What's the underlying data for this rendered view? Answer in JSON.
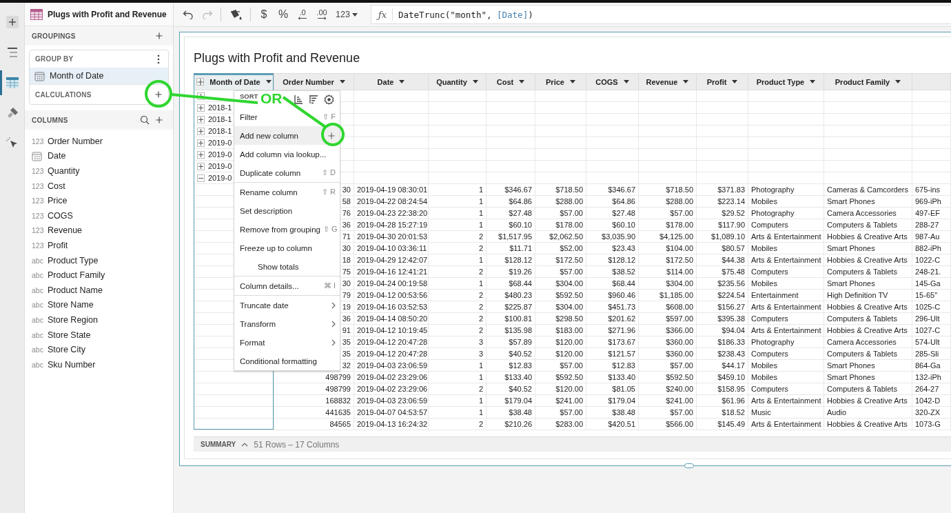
{
  "rail": {
    "items": [
      {
        "kind": "add",
        "selected": false
      },
      {
        "kind": "outline",
        "selected": false
      },
      {
        "kind": "table",
        "selected": true
      },
      {
        "kind": "brush",
        "selected": false
      },
      {
        "kind": "pointer",
        "selected": false
      }
    ]
  },
  "panel": {
    "title": "Plugs with Profit and Revenue",
    "groupings_label": "GROUPINGS",
    "group_by_label": "GROUP BY",
    "group_by": [
      {
        "kind": "date",
        "name": "Month of Date",
        "selected": true
      }
    ],
    "calculations_label": "CALCULATIONS",
    "columns_label": "COLUMNS",
    "columns": [
      {
        "kind": "number",
        "type_label": "123",
        "name": "Order Number"
      },
      {
        "kind": "date",
        "name": "Date"
      },
      {
        "kind": "number",
        "type_label": "123",
        "name": "Quantity"
      },
      {
        "kind": "number",
        "type_label": "123",
        "name": "Cost"
      },
      {
        "kind": "number",
        "type_label": "123",
        "name": "Price"
      },
      {
        "kind": "number",
        "type_label": "123",
        "name": "COGS"
      },
      {
        "kind": "number",
        "type_label": "123",
        "name": "Revenue"
      },
      {
        "kind": "number",
        "type_label": "123",
        "name": "Profit"
      },
      {
        "kind": "text",
        "type_label": "abc",
        "name": "Product Type"
      },
      {
        "kind": "text",
        "type_label": "abc",
        "name": "Product Family"
      },
      {
        "kind": "text",
        "type_label": "abc",
        "name": "Product Name"
      },
      {
        "kind": "text",
        "type_label": "abc",
        "name": "Store Name"
      },
      {
        "kind": "text",
        "type_label": "abc",
        "name": "Store Region"
      },
      {
        "kind": "text",
        "type_label": "abc",
        "name": "Store State"
      },
      {
        "kind": "text",
        "type_label": "abc",
        "name": "Store City"
      },
      {
        "kind": "text",
        "type_label": "abc",
        "name": "Sku Number"
      }
    ]
  },
  "toolbar": {
    "buttons": [
      {
        "kind": "undo",
        "disabled": false
      },
      {
        "kind": "redo",
        "disabled": true
      },
      {
        "kind": "fill",
        "disabled": false
      },
      {
        "kind": "symbol",
        "text": "$",
        "disabled": false
      },
      {
        "kind": "symbol",
        "text": "%",
        "disabled": false
      },
      {
        "kind": "decimal_less",
        "text": ".0",
        "disabled": false
      },
      {
        "kind": "decimal_more",
        "text": ".00",
        "disabled": false
      },
      {
        "kind": "dropdown",
        "text": "123",
        "disabled": false
      }
    ]
  },
  "formula": {
    "symbol": "ƒx",
    "parts": [
      {
        "kind": "plain",
        "text": "DateTrunc(\"month\", "
      },
      {
        "kind": "ref",
        "text": "[Date]"
      },
      {
        "kind": "plain",
        "text": ")"
      }
    ]
  },
  "element": {
    "title": "Plugs with Profit and Revenue",
    "table": {
      "columns": [
        {
          "kind": "group",
          "label": "Month of Date",
          "selected": true
        },
        {
          "kind": "number",
          "label": "Order Number",
          "selected": false
        },
        {
          "kind": "date",
          "label": "Date",
          "selected": false
        },
        {
          "kind": "number",
          "label": "Quantity",
          "selected": false
        },
        {
          "kind": "number",
          "label": "Cost",
          "selected": false
        },
        {
          "kind": "number",
          "label": "Price",
          "selected": false
        },
        {
          "kind": "number",
          "label": "COGS",
          "selected": false
        },
        {
          "kind": "number",
          "label": "Revenue",
          "selected": false
        },
        {
          "kind": "number",
          "label": "Profit",
          "selected": false
        },
        {
          "kind": "text",
          "label": "Product Type",
          "selected": false
        },
        {
          "kind": "text",
          "label": "Product Family",
          "selected": false
        },
        {
          "kind": "text",
          "selected": false
        }
      ],
      "group_rows": [
        {
          "expanded": false
        },
        {
          "label": "2018-1",
          "expanded": false
        },
        {
          "label": "2018-1",
          "expanded": false
        },
        {
          "label": "2018-1",
          "expanded": false
        },
        {
          "label": "2019-0",
          "expanded": false
        },
        {
          "label": "2019-0",
          "expanded": false
        },
        {
          "label": "2019-0",
          "expanded": false
        },
        {
          "label": "2019-0",
          "expanded": true
        }
      ],
      "rows": [
        [
          "",
          "30",
          "2019-04-19 08:30:01",
          "1",
          "$346.67",
          "$718.50",
          "$346.67",
          "$718.50",
          "$371.83",
          "Photography",
          "Cameras & Camcorders",
          "675-ins"
        ],
        [
          "",
          "58",
          "2019-04-22 08:24:54",
          "1",
          "$64.86",
          "$288.00",
          "$64.86",
          "$288.00",
          "$223.14",
          "Mobiles",
          "Smart Phones",
          "969-iPh"
        ],
        [
          "",
          "76",
          "2019-04-23 22:38:20",
          "1",
          "$27.48",
          "$57.00",
          "$27.48",
          "$57.00",
          "$29.52",
          "Photography",
          "Camera Accessories",
          "497-EF"
        ],
        [
          "",
          "36",
          "2019-04-28 15:27:19",
          "1",
          "$60.10",
          "$178.00",
          "$60.10",
          "$178.00",
          "$117.90",
          "Computers",
          "Computers & Tablets",
          "288-27"
        ],
        [
          "",
          "71",
          "2019-04-30 20:01:53",
          "2",
          "$1,517.95",
          "$2,062.50",
          "$3,035.90",
          "$4,125.00",
          "$1,089.10",
          "Arts & Entertainment",
          "Hobbies & Creative Arts",
          "987-Au"
        ],
        [
          "",
          "30",
          "2019-04-10 03:36:11",
          "2",
          "$11.71",
          "$52.00",
          "$23.43",
          "$104.00",
          "$80.57",
          "Mobiles",
          "Smart Phones",
          "882-iPh"
        ],
        [
          "",
          "18",
          "2019-04-29 12:42:07",
          "1",
          "$128.12",
          "$172.50",
          "$128.12",
          "$172.50",
          "$44.38",
          "Arts & Entertainment",
          "Hobbies & Creative Arts",
          "1022-C"
        ],
        [
          "",
          "75",
          "2019-04-16 12:41:21",
          "2",
          "$19.26",
          "$57.00",
          "$38.52",
          "$114.00",
          "$75.48",
          "Computers",
          "Computers & Tablets",
          "248-21."
        ],
        [
          "",
          "30",
          "2019-04-24 00:19:58",
          "1",
          "$68.44",
          "$304.00",
          "$68.44",
          "$304.00",
          "$235.56",
          "Mobiles",
          "Smart Phones",
          "145-Ga"
        ],
        [
          "",
          "79",
          "2019-04-12 00:53:56",
          "2",
          "$480.23",
          "$592.50",
          "$960.46",
          "$1,185.00",
          "$224.54",
          "Entertainment",
          "High Definition TV",
          "15-65\""
        ],
        [
          "",
          "19",
          "2019-04-16 03:52:53",
          "2",
          "$225.87",
          "$304.00",
          "$451.73",
          "$608.00",
          "$156.27",
          "Arts & Entertainment",
          "Hobbies & Creative Arts",
          "1025-C"
        ],
        [
          "",
          "36",
          "2019-04-14 08:50:20",
          "2",
          "$100.81",
          "$298.50",
          "$201.62",
          "$597.00",
          "$395.38",
          "Computers",
          "Computers & Tablets",
          "296-Ult"
        ],
        [
          "",
          "91",
          "2019-04-12 10:19:45",
          "2",
          "$135.98",
          "$183.00",
          "$271.96",
          "$366.00",
          "$94.04",
          "Arts & Entertainment",
          "Hobbies & Creative Arts",
          "1027-C"
        ],
        [
          "",
          "35",
          "2019-04-12 20:47:28",
          "3",
          "$57.89",
          "$120.00",
          "$173.67",
          "$360.00",
          "$186.33",
          "Photography",
          "Camera Accessories",
          "574-Ult"
        ],
        [
          "",
          "35",
          "2019-04-12 20:47:28",
          "3",
          "$40.52",
          "$120.00",
          "$121.57",
          "$360.00",
          "$238.43",
          "Computers",
          "Computers & Tablets",
          "285-Sli"
        ],
        [
          "",
          "32",
          "2019-04-03 23:06:59",
          "1",
          "$12.83",
          "$57.00",
          "$12.83",
          "$57.00",
          "$44.17",
          "Mobiles",
          "Smart Phones",
          "864-Ga"
        ],
        [
          "",
          "498799",
          "2019-04-02 23:29:06",
          "1",
          "$133.40",
          "$592.50",
          "$133.40",
          "$592.50",
          "$459.10",
          "Mobiles",
          "Smart Phones",
          "132-iPh"
        ],
        [
          "",
          "498799",
          "2019-04-02 23:29:06",
          "2",
          "$40.52",
          "$120.00",
          "$81.05",
          "$240.00",
          "$158.95",
          "Computers",
          "Computers & Tablets",
          "264-27"
        ],
        [
          "",
          "168832",
          "2019-04-03 23:06:59",
          "1",
          "$179.04",
          "$241.00",
          "$179.04",
          "$241.00",
          "$61.96",
          "Arts & Entertainment",
          "Hobbies & Creative Arts",
          "1042-D"
        ],
        [
          "",
          "441635",
          "2019-04-07 04:53:57",
          "1",
          "$38.48",
          "$57.00",
          "$38.48",
          "$57.00",
          "$18.52",
          "Music",
          "Audio",
          "320-ZX"
        ],
        [
          "",
          "84565",
          "2019-04-13 16:24:32",
          "2",
          "$210.26",
          "$283.00",
          "$420.51",
          "$566.00",
          "$145.49",
          "Arts & Entertainment",
          "Hobbies & Creative Arts",
          "1073-G"
        ]
      ]
    },
    "menu": {
      "heading": "SORT",
      "items": [
        {
          "kind": "item",
          "label": "Filter",
          "shortcut": "⇧ F",
          "highlighted": false
        },
        {
          "kind": "add",
          "label": "Add new column",
          "highlighted": true
        },
        {
          "kind": "item",
          "label": "Add column via lookup...",
          "highlighted": false
        },
        {
          "kind": "item",
          "label": "Duplicate column",
          "shortcut": "⇧ D",
          "highlighted": false
        },
        {
          "kind": "divider"
        },
        {
          "kind": "item",
          "label": "Rename column",
          "shortcut": "⇧ R",
          "highlighted": false
        },
        {
          "kind": "item",
          "label": "Set description",
          "highlighted": false
        },
        {
          "kind": "item",
          "label": "Remove from grouping",
          "shortcut": "⇧ G",
          "highlighted": false
        },
        {
          "kind": "item",
          "label": "Freeze up to column",
          "highlighted": false
        },
        {
          "kind": "indent",
          "label": "Show totals",
          "highlighted": false
        },
        {
          "kind": "divider"
        },
        {
          "kind": "item",
          "label": "Column details...",
          "shortcut": "⌘ I",
          "highlighted": false
        },
        {
          "kind": "divider"
        },
        {
          "kind": "submenu",
          "label": "Truncate date",
          "highlighted": false
        },
        {
          "kind": "submenu",
          "label": "Transform",
          "highlighted": false
        },
        {
          "kind": "submenu",
          "label": "Format",
          "highlighted": false
        },
        {
          "kind": "item",
          "label": "Conditional formatting",
          "highlighted": false
        }
      ]
    },
    "summary": {
      "label": "SUMMARY",
      "text": "51 Rows – 17 Columns"
    }
  },
  "annotation": {
    "text": "OR"
  }
}
